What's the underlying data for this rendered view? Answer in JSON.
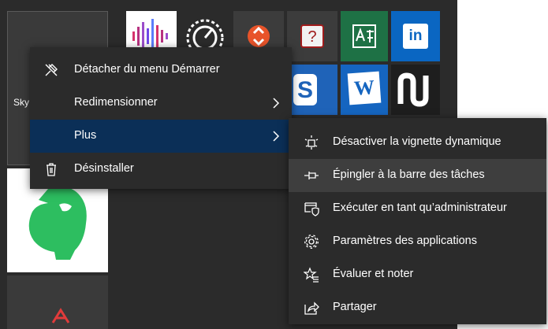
{
  "tiles": {
    "skype_label": "Sky",
    "linkedin_text": "in",
    "word_text": "W"
  },
  "context_menu": {
    "items": [
      {
        "label": "Détacher du menu Démarrer",
        "icon": "unpin-icon"
      },
      {
        "label": "Redimensionner",
        "icon": "none",
        "submenu": true
      },
      {
        "label": "Plus",
        "icon": "none",
        "submenu": true,
        "active": true
      },
      {
        "label": "Désinstaller",
        "icon": "trash-icon"
      }
    ]
  },
  "submenu": {
    "items": [
      {
        "label": "Désactiver la vignette dynamique",
        "icon": "live-tile-icon"
      },
      {
        "label": "Épingler à la barre des tâches",
        "icon": "pin-icon",
        "hover": true
      },
      {
        "label": "Exécuter en tant qu’administrateur",
        "icon": "admin-shield-icon"
      },
      {
        "label": "Paramètres des applications",
        "icon": "gear-icon"
      },
      {
        "label": "Évaluer et noter",
        "icon": "star-list-icon"
      },
      {
        "label": "Partager",
        "icon": "share-icon"
      }
    ]
  },
  "colors": {
    "menu_background": "#2b2b2b",
    "active_item": "#0b2f57",
    "hover_item": "#3e3e3e",
    "linkedin_blue": "#0a66c2",
    "evernote_green": "#2dbe60",
    "teams_tile": "#1e7145",
    "word_blue": "#1565c0"
  }
}
